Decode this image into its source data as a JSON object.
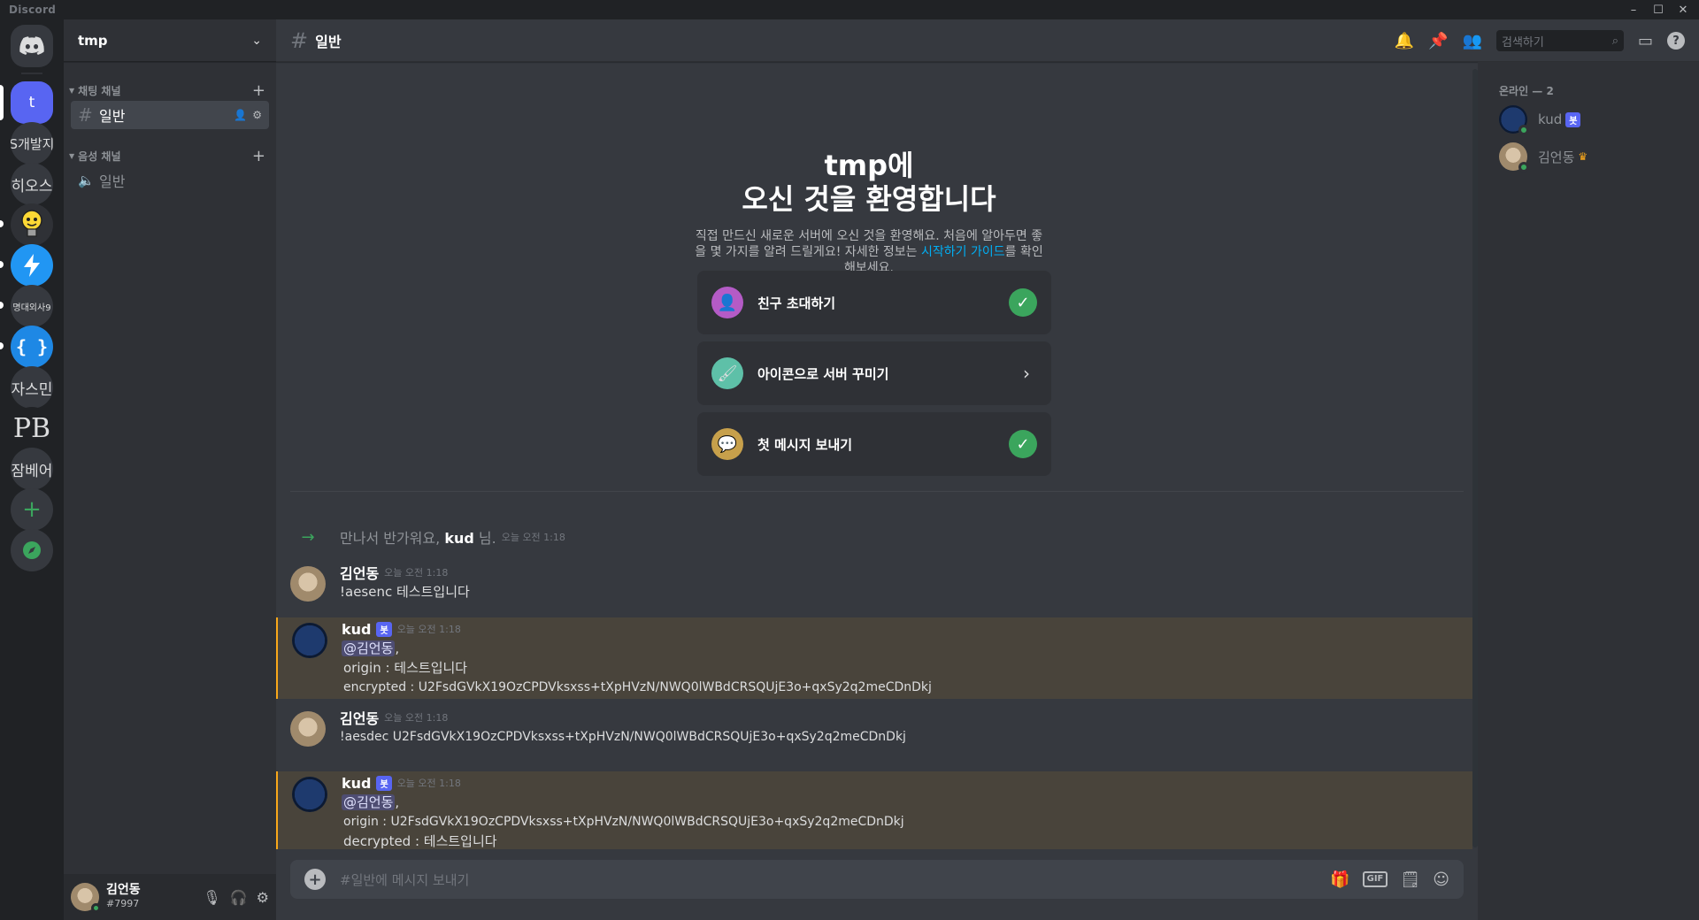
{
  "window": {
    "title": "Discord"
  },
  "rail": {
    "servers": [
      {
        "label": "t"
      },
      {
        "label": "S개발지"
      },
      {
        "label": "히오스"
      },
      {
        "label": ""
      },
      {
        "label": ""
      },
      {
        "label": "명대외사9"
      },
      {
        "label": ""
      },
      {
        "label": "자스민"
      },
      {
        "label": "PB"
      },
      {
        "label": "잠베어"
      }
    ]
  },
  "guild": {
    "name": "tmp"
  },
  "sidebar": {
    "text_category": "채팅 채널",
    "voice_category": "음성 채널",
    "text_channel": "일반",
    "voice_channel": "일반"
  },
  "user": {
    "name": "김언동",
    "tag": "#7997"
  },
  "channel": {
    "title": "일반",
    "search_placeholder": "검색하기"
  },
  "welcome": {
    "line1": "tmp에",
    "line2": "오신 것을 환영합니다",
    "desc_a": "직접 만드신 새로운 서버에 오신 것을 환영해요. 처음에 알아두면 좋을 몇 가지를 알려 드릴게요! 자세한 정보는 ",
    "desc_link": "시작하기 가이드",
    "desc_b": "를 확인해보세요.",
    "cards": [
      {
        "label": "친구 초대하기",
        "done": true
      },
      {
        "label": "아이콘으로 서버 꾸미기",
        "done": false
      },
      {
        "label": "첫 메시지 보내기",
        "done": true
      }
    ]
  },
  "join": {
    "prefix": "만나서 반가워요, ",
    "user": "kud",
    "suffix": " 님.",
    "time": "오늘 오전 1:18"
  },
  "messages": [
    {
      "author": "김언동",
      "time": "오늘 오전 1:18",
      "lines": [
        "!aesenc 테스트입니다"
      ]
    },
    {
      "author": "kud",
      "badge": "봇",
      "time": "오늘 오전 1:18",
      "mention": "@김언동",
      "lines": [
        "origin : 테스트입니다",
        "encrypted : U2FsdGVkX19OzCPDVksxss+tXpHVzN/NWQ0lWBdCRSQUjE3o+qxSy2q2meCDnDkj"
      ]
    },
    {
      "author": "김언동",
      "time": "오늘 오전 1:18",
      "lines": [
        "!aesdec U2FsdGVkX19OzCPDVksxss+tXpHVzN/NWQ0lWBdCRSQUjE3o+qxSy2q2meCDnDkj"
      ]
    },
    {
      "author": "kud",
      "badge": "봇",
      "time": "오늘 오전 1:18",
      "mention": "@김언동",
      "lines": [
        "origin : U2FsdGVkX19OzCPDVksxss+tXpHVzN/NWQ0lWBdCRSQUjE3o+qxSy2q2meCDnDkj",
        "decrypted : 테스트입니다"
      ]
    }
  ],
  "composer": {
    "placeholder": "#일반에 메시지 보내기",
    "gif": "GIF"
  },
  "members": {
    "header": "온라인 — 2",
    "list": [
      {
        "name": "kud",
        "badge": "봇"
      },
      {
        "name": "김언동",
        "crown": "♛"
      }
    ]
  }
}
